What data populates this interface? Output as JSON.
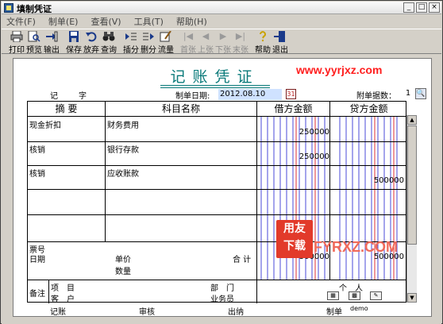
{
  "window": {
    "title": "填制凭证"
  },
  "menu": [
    {
      "label": "文件(F)"
    },
    {
      "label": "制单(E)"
    },
    {
      "label": "查看(V)"
    },
    {
      "label": "工具(T)"
    },
    {
      "label": "帮助(H)"
    }
  ],
  "toolbar": {
    "print": "打印",
    "preview": "预览",
    "export": "输出",
    "save": "保存",
    "discard": "放弃",
    "query": "查询",
    "insert_line": "插分",
    "delete_line": "删分",
    "flow": "流量",
    "first": "首张",
    "prev": "上张",
    "next": "下张",
    "last": "末张",
    "help": "帮助",
    "exit": "退出"
  },
  "voucher": {
    "title": "记账凭证",
    "watermark": "www.yyrjxz.com",
    "type_label": "记",
    "type_suffix": "字",
    "date_label": "制单日期:",
    "date_value": "2012.08.10",
    "attach_label": "附单据数：",
    "attach_value": "1",
    "headers": {
      "summary": "摘 要",
      "account": "科目名称",
      "debit": "借方金额",
      "credit": "贷方金额"
    },
    "rows": [
      {
        "summary": "现金折扣",
        "account": "财务费用",
        "debit": "250000",
        "credit": ""
      },
      {
        "summary": "核销",
        "account": "银行存款",
        "debit": "250000",
        "credit": ""
      },
      {
        "summary": "核销",
        "account": "应收账款",
        "debit": "",
        "credit": "500000"
      },
      {
        "summary": "",
        "account": "",
        "debit": "",
        "credit": ""
      },
      {
        "summary": "",
        "account": "",
        "debit": "",
        "credit": ""
      }
    ],
    "total": {
      "bill_no_label": "票号",
      "date_label": "日期",
      "price_label": "单价",
      "qty_label": "数量",
      "total_label": "合 计",
      "debit": "500000",
      "credit": "500000"
    },
    "notes": {
      "remark_label": "备注",
      "project_label": "项　目",
      "customer_label": "客　户",
      "dept_label": "部　门",
      "person_label": "个　人",
      "salesman_label": "业务员"
    },
    "footer": {
      "bookkeeper": "记账",
      "reviewer": "审核",
      "cashier": "出纳",
      "maker": "制单",
      "maker_name": "demo"
    }
  },
  "logo": {
    "badge_top": "用友",
    "badge_bottom": "下载",
    "text": "FYRXZ.COM"
  }
}
